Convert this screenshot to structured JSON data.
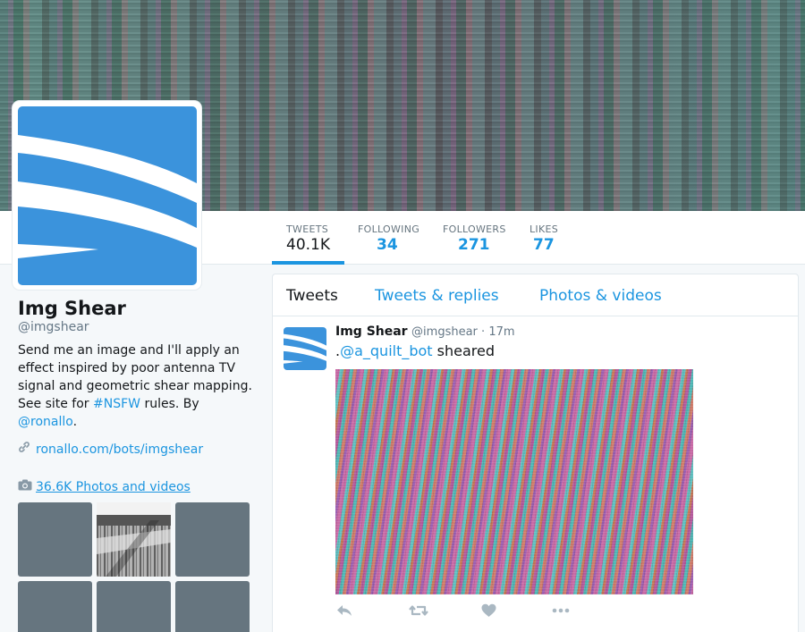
{
  "profile": {
    "name": "Img Shear",
    "handle": "@imgshear",
    "bio_prefix": "Send me an image and I'll apply an effect inspired by poor antenna TV signal and geometric shear mapping. See site for ",
    "bio_hashtag": "#NSFW",
    "bio_mid": " rules. By ",
    "bio_mention": "@ronallo",
    "bio_suffix": ".",
    "website": "ronallo.com/bots/imgshear",
    "photos_label": "36.6K Photos and videos"
  },
  "stats": [
    {
      "label": "TWEETS",
      "value": "40.1K"
    },
    {
      "label": "FOLLOWING",
      "value": "34"
    },
    {
      "label": "FOLLOWERS",
      "value": "271"
    },
    {
      "label": "LIKES",
      "value": "77"
    }
  ],
  "tabs": [
    "Tweets",
    "Tweets & replies",
    "Photos & videos"
  ],
  "tweet": {
    "name": "Img Shear",
    "handle": "@imgshear",
    "dot": " · ",
    "time": "17m",
    "text_prefix": ".",
    "mention": "@a_quilt_bot",
    "text_suffix": " sheared"
  },
  "icons": {
    "link": "link-icon",
    "camera": "camera-icon",
    "reply": "reply-icon",
    "retweet": "retweet-icon",
    "like": "heart-icon",
    "more": "more-icon"
  },
  "colors": {
    "accent": "#1b95e0",
    "avatar_blue": "#3b93dc"
  }
}
